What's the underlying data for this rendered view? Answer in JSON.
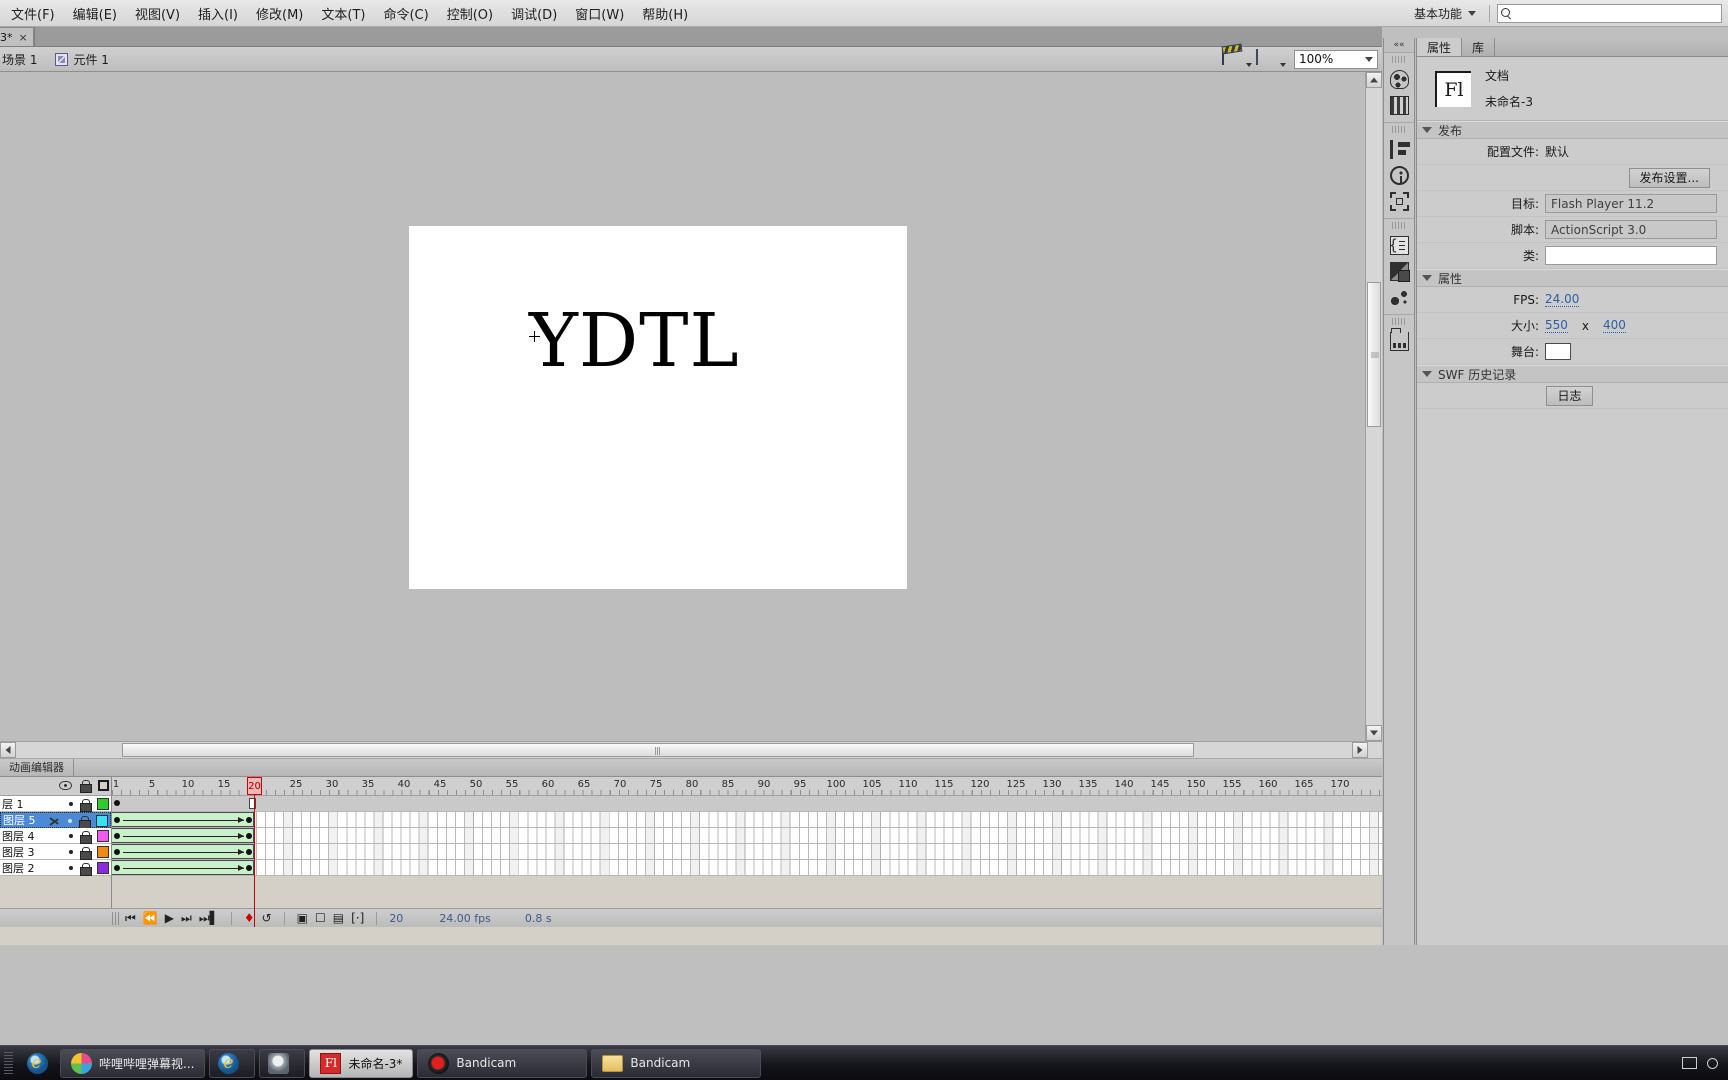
{
  "menu": {
    "items": [
      "文件(F)",
      "编辑(E)",
      "视图(V)",
      "插入(I)",
      "修改(M)",
      "文本(T)",
      "命令(C)",
      "控制(O)",
      "调试(D)",
      "窗口(W)",
      "帮助(H)"
    ],
    "workspace": "基本功能",
    "search_placeholder": ""
  },
  "document_tab": {
    "label": "3*",
    "close": "×"
  },
  "editbar": {
    "scene": "场景 1",
    "symbol": "元件 1",
    "zoom": "100%"
  },
  "stage": {
    "text": "YDTL",
    "background": "#ffffff"
  },
  "timeline": {
    "tabs": [
      "动画编辑器"
    ],
    "ruler_ticks": [
      "1",
      "5",
      "10",
      "15",
      "20",
      "25",
      "30",
      "35",
      "40",
      "45",
      "50",
      "55",
      "60",
      "65",
      "70",
      "75",
      "80",
      "85",
      "90",
      "95",
      "100",
      "105",
      "110",
      "115",
      "120",
      "125",
      "130",
      "135",
      "140",
      "145",
      "150",
      "155",
      "160",
      "165",
      "170"
    ],
    "layers": [
      {
        "name": "层 1",
        "color": "#2ecc2e",
        "selected": false,
        "locked": false,
        "kind": "blank"
      },
      {
        "name": "图层 5",
        "color": "#3de0f0",
        "selected": true,
        "locked": false,
        "kind": "tween"
      },
      {
        "name": "图层 4",
        "color": "#f05cf0",
        "selected": false,
        "locked": false,
        "kind": "tween"
      },
      {
        "name": "图层 3",
        "color": "#f08a10",
        "selected": false,
        "locked": false,
        "kind": "tween"
      },
      {
        "name": "图层 2",
        "color": "#8a2be2",
        "selected": false,
        "locked": false,
        "kind": "tween"
      }
    ],
    "playhead_frame": "20",
    "footer": {
      "current_frame": "20",
      "fps": "24.00 fps",
      "elapsed": "0.8 s"
    }
  },
  "properties": {
    "tabs": [
      {
        "label": "属性",
        "active": true
      },
      {
        "label": "库",
        "active": false
      }
    ],
    "doc_kind": "文档",
    "doc_name": "未命名-3",
    "badge": "Fl",
    "publish": {
      "title": "发布",
      "profile_label": "配置文件:",
      "profile_value": "默认",
      "settings_button": "发布设置...",
      "target_label": "目标:",
      "target_value": "Flash Player 11.2",
      "script_label": "脚本:",
      "script_value": "ActionScript 3.0",
      "class_label": "类:",
      "class_value": ""
    },
    "attrs": {
      "title": "属性",
      "fps_label": "FPS:",
      "fps_value": "24.00",
      "size_label": "大小:",
      "width": "550",
      "height": "400",
      "size_sep": "x",
      "stage_label": "舞台:",
      "stage_color": "#ffffff"
    },
    "swf_history": {
      "title": "SWF 历史记录",
      "log_button": "日志"
    }
  },
  "taskbar": {
    "items": [
      {
        "label": "",
        "icon": "ie-icon",
        "kind": "plain"
      },
      {
        "label": "哔哩哔哩弹幕视...",
        "icon": "bilibili-icon",
        "kind": "normal"
      },
      {
        "label": "",
        "icon": "ie-icon",
        "kind": "plain"
      },
      {
        "label": "",
        "icon": "generic-app-icon",
        "kind": "plain"
      },
      {
        "label": "未命名-3*",
        "icon": "flash-icon",
        "kind": "active"
      },
      {
        "label": "Bandicam",
        "icon": "record-icon",
        "kind": "normal"
      },
      {
        "label": "Bandicam",
        "icon": "folder-icon",
        "kind": "normal"
      }
    ]
  }
}
